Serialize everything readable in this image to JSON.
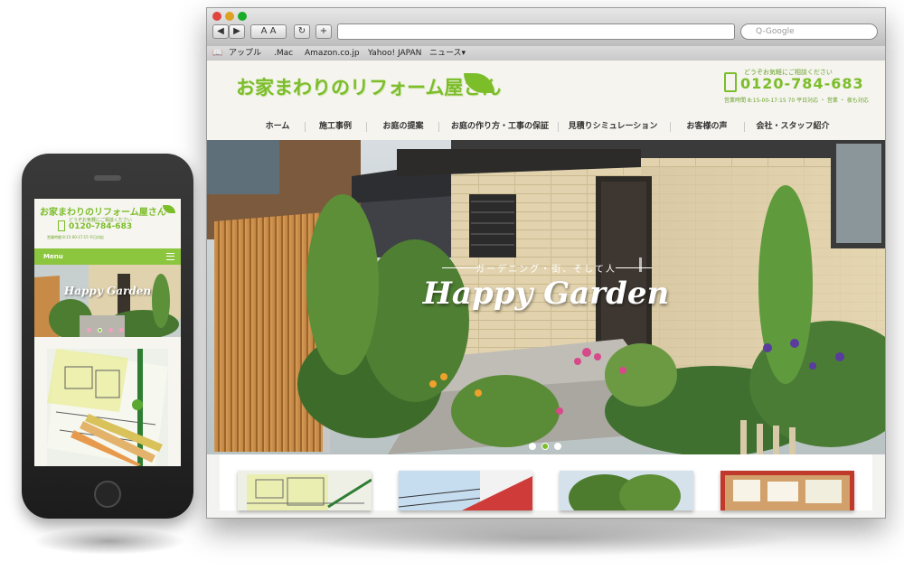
{
  "browser": {
    "toolbar": {
      "text_size_label": "A A",
      "reload_label": "↻",
      "add_label": "+",
      "search_placeholder": "Q-Google"
    },
    "bookmarks": [
      "アップル",
      ".Mac",
      "Amazon.co.jp",
      "Yahoo! JAPAN",
      "ニュース▾"
    ]
  },
  "site": {
    "logo": "お家まわりのリフォーム屋さん",
    "contact_note": "どうぞお気軽にご相談ください",
    "phone": "0120-784-683",
    "hours": "営業時間 8:15-00-17:15 70 平日対応 ・ 営業 ・ 夜も対応",
    "nav": [
      "ホーム",
      "施工事例",
      "お庭の提案",
      "お庭の作り方・工事の保証",
      "見積りシミュレーション",
      "お客様の声",
      "会社・スタッフ紹介"
    ],
    "hero_tagline": "ガーデニング・街、そして人",
    "hero_title": "Happy Garden",
    "slide_count": 3,
    "active_slide": 1
  },
  "mobile": {
    "logo": "お家まわりのリフォーム屋さん",
    "contact_note": "どうぞお気軽にご相談ください",
    "phone": "0120-784-683",
    "hours": "営業時間 8:15-00-17:15 平日対応",
    "menu_label": "Menu",
    "hero_title": "Happy Garden"
  },
  "colors": {
    "brand_green": "#7cbd2a",
    "menu_green": "#8cc63f"
  }
}
